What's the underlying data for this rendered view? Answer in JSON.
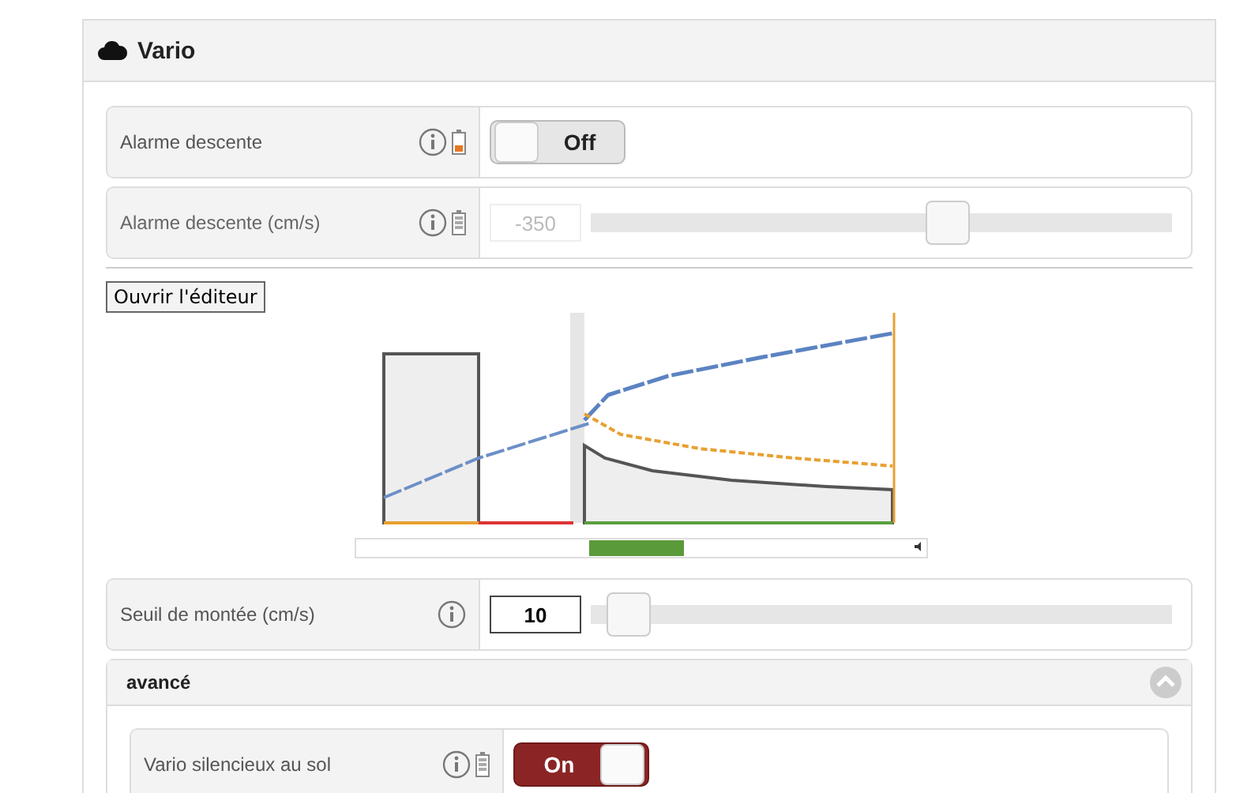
{
  "section": {
    "title": "Vario"
  },
  "rows": [
    {
      "kind": "toggle",
      "label": "Alarme descente",
      "battery_low": true,
      "on": false,
      "value": "Off"
    },
    {
      "kind": "slider",
      "label": "Alarme descente (cm/s)",
      "battery_low": false,
      "value": "-350",
      "level": 0.62,
      "disabled": true
    }
  ],
  "editor": {
    "button": "Ouvrir l'éditeur"
  },
  "rows_after": [
    {
      "kind": "slider",
      "label": "Seuil de montée (cm/s)",
      "value": "10",
      "level": 0.03,
      "disabled": false
    }
  ],
  "advanced": {
    "title": "avancé",
    "expanded": true,
    "rows": [
      {
        "kind": "toggle",
        "label": "Vario silencieux au sol",
        "battery_low": false,
        "on": true,
        "value": "On"
      }
    ]
  }
}
